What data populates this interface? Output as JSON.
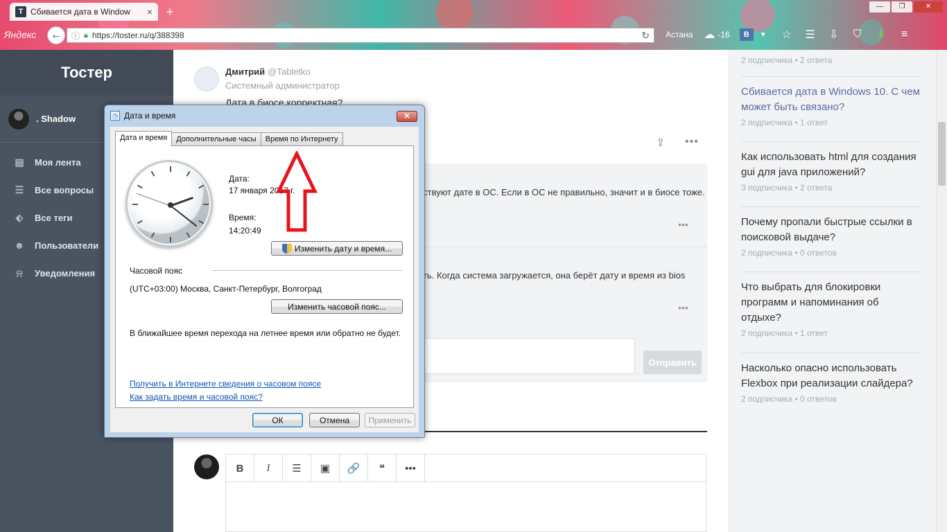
{
  "browser": {
    "tab_title": "Сбивается дата в Window",
    "tab_favicon": "T",
    "url": "https://toster.ru/q/388398",
    "yandex_logo": "Яндекс",
    "city": "Астана",
    "temperature": "-16",
    "vk_label": "В",
    "icons": [
      "back-icon",
      "info-icon",
      "lock-icon",
      "reload-icon",
      "weather-icon",
      "star-icon",
      "bookmarks-icon",
      "download-icon",
      "pocket-icon",
      "addon-icon",
      "menu-icon"
    ]
  },
  "sidebar": {
    "brand": "Тостер",
    "user_name": ". Shadow",
    "items": [
      {
        "label": "Моя лента",
        "icon": "feed-icon"
      },
      {
        "label": "Все вопросы",
        "icon": "questions-icon"
      },
      {
        "label": "Все теги",
        "icon": "tag-icon"
      },
      {
        "label": "Пользователи",
        "icon": "users-icon"
      },
      {
        "label": "Уведомления",
        "icon": "bell-icon"
      }
    ]
  },
  "question": {
    "author": "Дмитрий",
    "handle": "@Tabletko",
    "role": "Системный администратор",
    "text": "Дата в биосе корректная?",
    "answer1": "ствуют дате в ОС. Если в ОС не правильно, значит и в биосе тоже.",
    "answer2": "ть. Когда система загружается, она берёт дату и время из bios",
    "send_button": "Отправить",
    "more": "•••"
  },
  "editor": {
    "buttons": [
      "B",
      "I",
      "☰",
      "▣",
      "🔗",
      "❝",
      "•••"
    ]
  },
  "right": {
    "items": [
      {
        "title": "",
        "meta": "2 подписчика • 2 ответа",
        "link": false
      },
      {
        "title": "Сбивается дата в Windows 10. С чем может быть связано?",
        "meta": "2 подписчика • 1 ответ",
        "link": true
      },
      {
        "title": "Как использовать html для создания gui для java приложений?",
        "meta": "3 подписчика • 2 ответа",
        "link": false
      },
      {
        "title": "Почему пропали быстрые ссылки в поисковой выдаче?",
        "meta": "2 подписчика • 0 ответов",
        "link": false
      },
      {
        "title": "Что выбрать для блокировки программ и напоминания об отдыхе?",
        "meta": "2 подписчика • 1 ответ",
        "link": false
      },
      {
        "title": "Насколько опасно использовать Flexbox при реализации слайдера?",
        "meta": "2 подписчика • 0 ответов",
        "link": false
      }
    ]
  },
  "dialog": {
    "title": "Дата и время",
    "tabs": [
      "Дата и время",
      "Дополнительные часы",
      "Время по Интернету"
    ],
    "active_tab": "Дата и время",
    "date_label": "Дата:",
    "date_value": "17 января 2017 г.",
    "time_label": "Время:",
    "time_value": "14:20:49",
    "change_datetime": "Изменить дату и время...",
    "tz_label": "Часовой пояс",
    "tz_value": "(UTC+03:00) Москва, Санкт-Петербург, Волгоград",
    "change_tz": "Изменить часовой пояс...",
    "dst_note": "В ближайшее время перехода на летнее время или обратно не будет.",
    "link1": "Получить в Интернете сведения о часовом поясе",
    "link2": "Как задать время и часовой пояс?",
    "ok": "ОК",
    "cancel": "Отмена",
    "apply": "Применить",
    "close": "✕"
  },
  "colors": {
    "sidebar": "#4a5461",
    "accent_link": "#5b6aa1",
    "arrow": "#e8141c"
  }
}
